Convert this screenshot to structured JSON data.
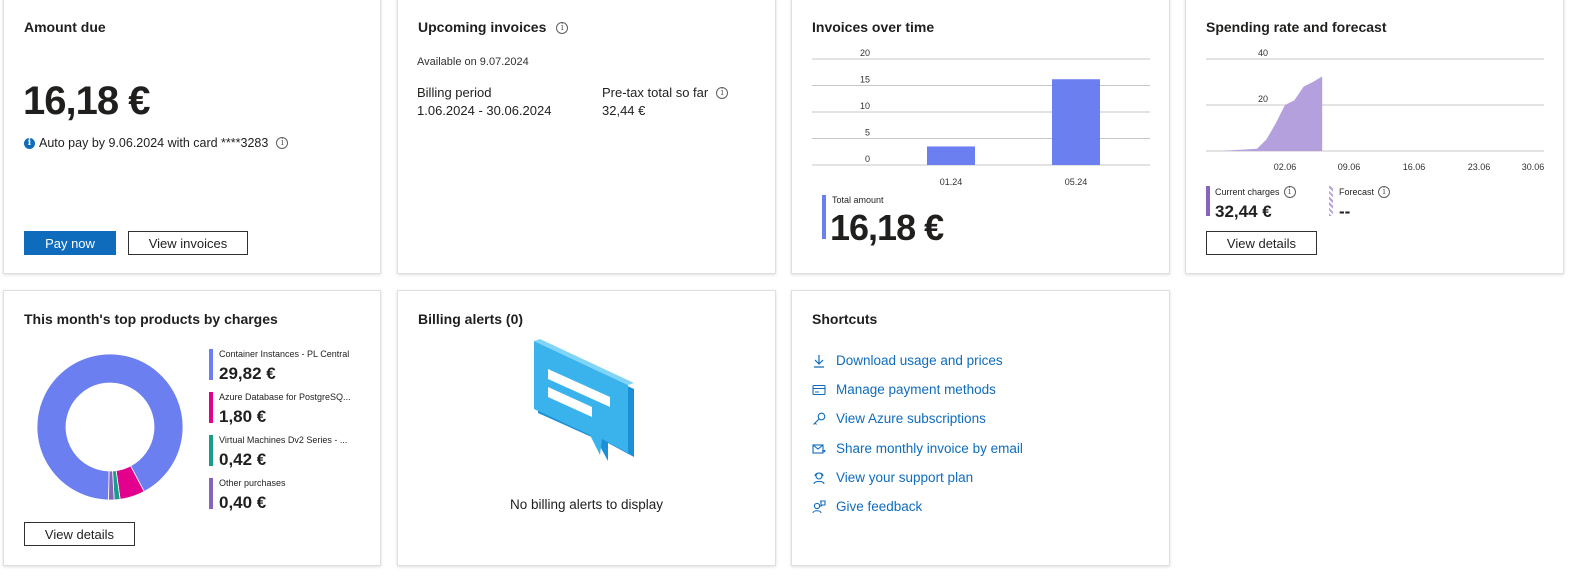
{
  "amount_due": {
    "title": "Amount due",
    "amount": "16,18 €",
    "autopay_text": "Auto pay by 9.06.2024 with card ****3283",
    "pay_now": "Pay now",
    "view_invoices": "View invoices"
  },
  "upcoming": {
    "title": "Upcoming invoices",
    "available": "Available on 9.07.2024",
    "billing_period_label": "Billing period",
    "billing_period_value": "1.06.2024 - 30.06.2024",
    "pretax_label": "Pre-tax total so far",
    "pretax_value": "32,44 €"
  },
  "invoices_over_time": {
    "title": "Invoices over time",
    "total_label": "Total amount",
    "total_value": "16,18 €",
    "bar_color": "#6b7ff0"
  },
  "spending": {
    "title": "Spending rate and forecast",
    "current_label": "Current charges",
    "current_value": "32,44 €",
    "forecast_label": "Forecast",
    "forecast_value": "--",
    "view_details": "View details",
    "area_color": "#b4a0dc"
  },
  "top_products": {
    "title": "This month's top products by charges",
    "view_details": "View details",
    "items": [
      {
        "name": "Container Instances - PL Central",
        "value": "29,82 €",
        "amount": 29.82,
        "color": "#6b7ff0"
      },
      {
        "name": "Azure Database for PostgreSQ...",
        "value": "1,80 €",
        "amount": 1.8,
        "color": "#e3008c"
      },
      {
        "name": "Virtual Machines Dv2 Series - ...",
        "value": "0,42 €",
        "amount": 0.42,
        "color": "#1a9b8c"
      },
      {
        "name": "Other purchases",
        "value": "0,40 €",
        "amount": 0.4,
        "color": "#8764b8"
      }
    ]
  },
  "billing_alerts": {
    "title": "Billing alerts (0)",
    "empty_text": "No billing alerts to display"
  },
  "shortcuts": {
    "title": "Shortcuts",
    "items": [
      {
        "label": "Download usage and prices",
        "icon": "download-icon"
      },
      {
        "label": "Manage payment methods",
        "icon": "payment-card-icon"
      },
      {
        "label": "View Azure subscriptions",
        "icon": "key-icon"
      },
      {
        "label": "Share monthly invoice by email",
        "icon": "mail-share-icon"
      },
      {
        "label": "View your support plan",
        "icon": "support-person-icon"
      },
      {
        "label": "Give feedback",
        "icon": "feedback-person-icon"
      }
    ]
  },
  "chart_data": [
    {
      "type": "bar",
      "categories": [
        "01.24",
        "05.24"
      ],
      "values": [
        3.5,
        16.18
      ],
      "title": "Invoices over time",
      "ylim": [
        0,
        20
      ],
      "yticks": [
        0,
        5,
        10,
        15,
        20
      ],
      "grid": true
    },
    {
      "type": "area",
      "x": [
        "26.05",
        "30.05",
        "31.05",
        "01.06",
        "02.06",
        "03.06",
        "04.06",
        "05.06",
        "06.06"
      ],
      "values": [
        0,
        1,
        5,
        12,
        20,
        22,
        28,
        30,
        32.44
      ],
      "xticks": [
        "02.06",
        "09.06",
        "16.06",
        "23.06",
        "30.06"
      ],
      "yticks": [
        0,
        20,
        40
      ],
      "ylim": [
        0,
        40
      ],
      "title": "Spending rate and forecast",
      "grid": true
    }
  ]
}
